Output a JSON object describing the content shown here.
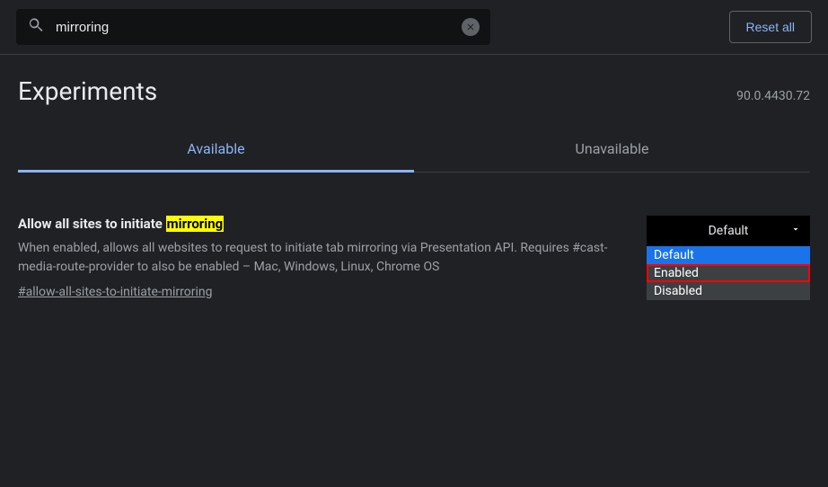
{
  "search": {
    "value": "mirroring"
  },
  "reset_label": "Reset all",
  "page_title": "Experiments",
  "version": "90.0.4430.72",
  "tabs": {
    "available": "Available",
    "unavailable": "Unavailable"
  },
  "flag": {
    "title_prefix": "Allow all sites to initiate ",
    "title_highlight": "mirroring",
    "description": "When enabled, allows all websites to request to initiate tab mirroring via Presentation API. Requires #cast-media-route-provider to also be enabled – Mac, Windows, Linux, Chrome OS",
    "hash_link": "#allow-all-sites-to-initiate-mirroring"
  },
  "dropdown": {
    "current": "Default",
    "options": {
      "default": "Default",
      "enabled": "Enabled",
      "disabled": "Disabled"
    }
  }
}
